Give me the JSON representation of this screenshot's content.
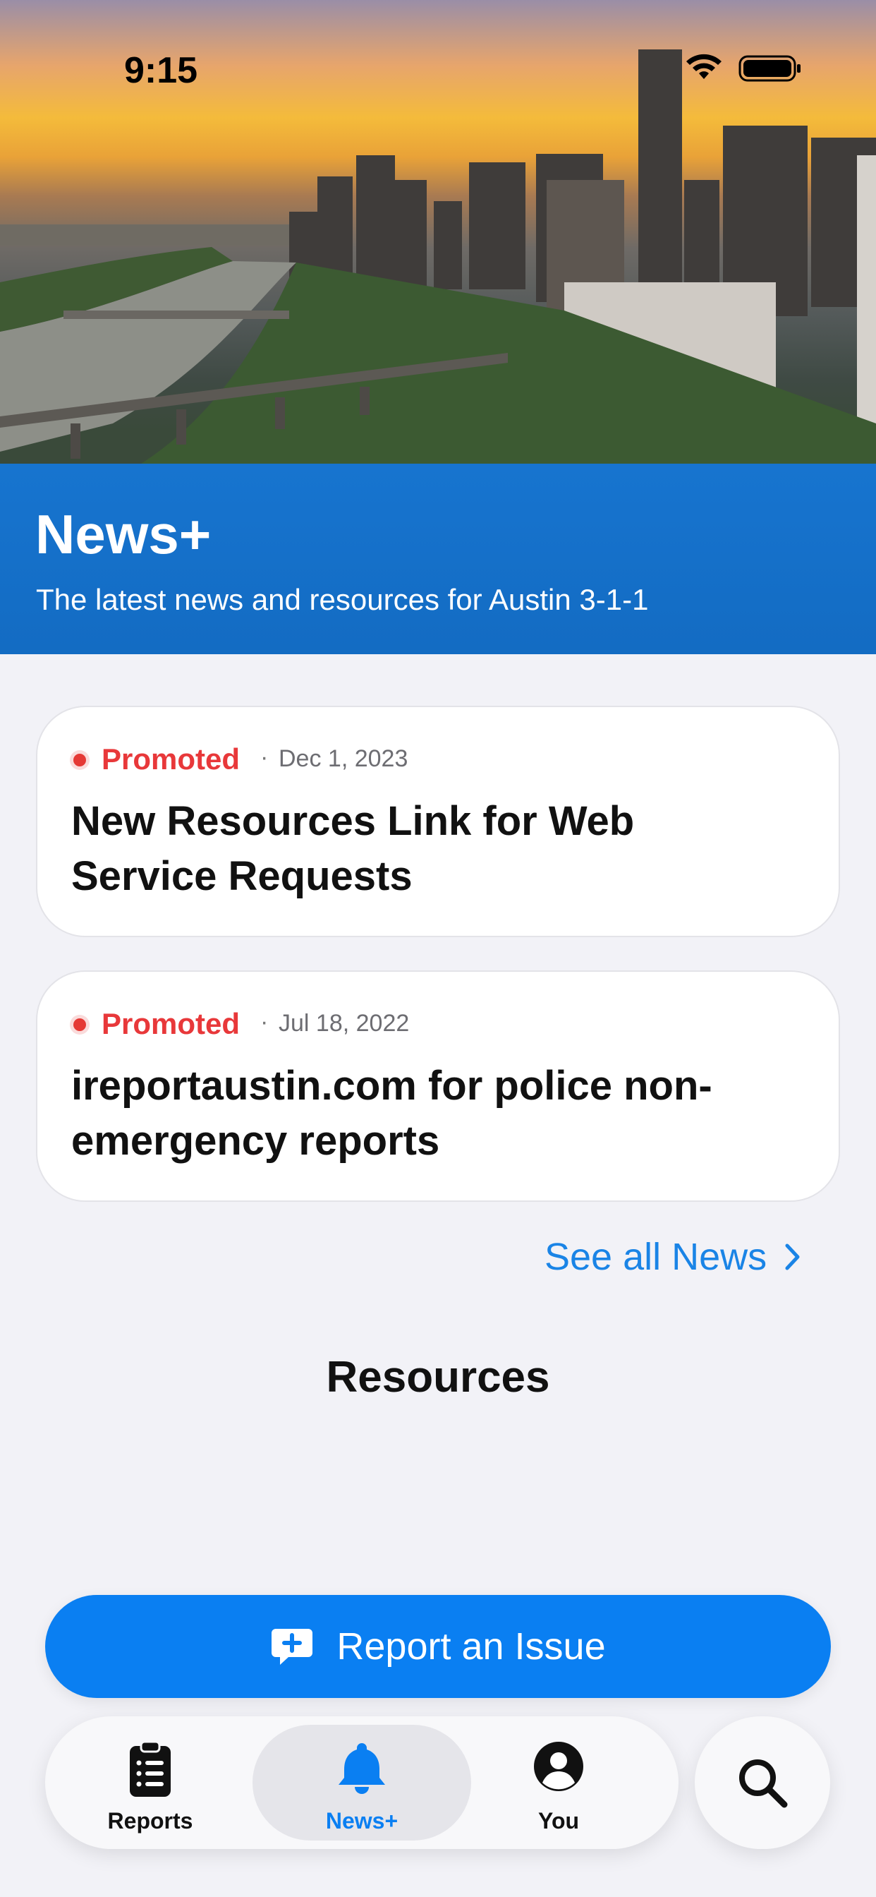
{
  "status_bar": {
    "time": "9:15"
  },
  "header": {
    "title": "News+",
    "subtitle": "The latest news and resources for Austin 3-1-1"
  },
  "news": [
    {
      "badge": "Promoted",
      "date": "Dec 1, 2023",
      "title": "New Resources Link for Web Service Requests"
    },
    {
      "badge": "Promoted",
      "date": "Jul 18, 2022",
      "title": "ireportaustin.com for police non-emergency reports"
    }
  ],
  "see_all_label": "See all News",
  "resources_heading": "Resources",
  "report_button_label": "Report an Issue",
  "tabs": [
    {
      "label": "Reports",
      "icon": "clipboard-icon",
      "active": false
    },
    {
      "label": "News+",
      "icon": "bell-icon",
      "active": true
    },
    {
      "label": "You",
      "icon": "person-icon",
      "active": false
    }
  ],
  "colors": {
    "accent": "#0a7ff2",
    "promoted": "#e8383a",
    "header_band": "#1478dc",
    "background": "#f2f2f7"
  }
}
